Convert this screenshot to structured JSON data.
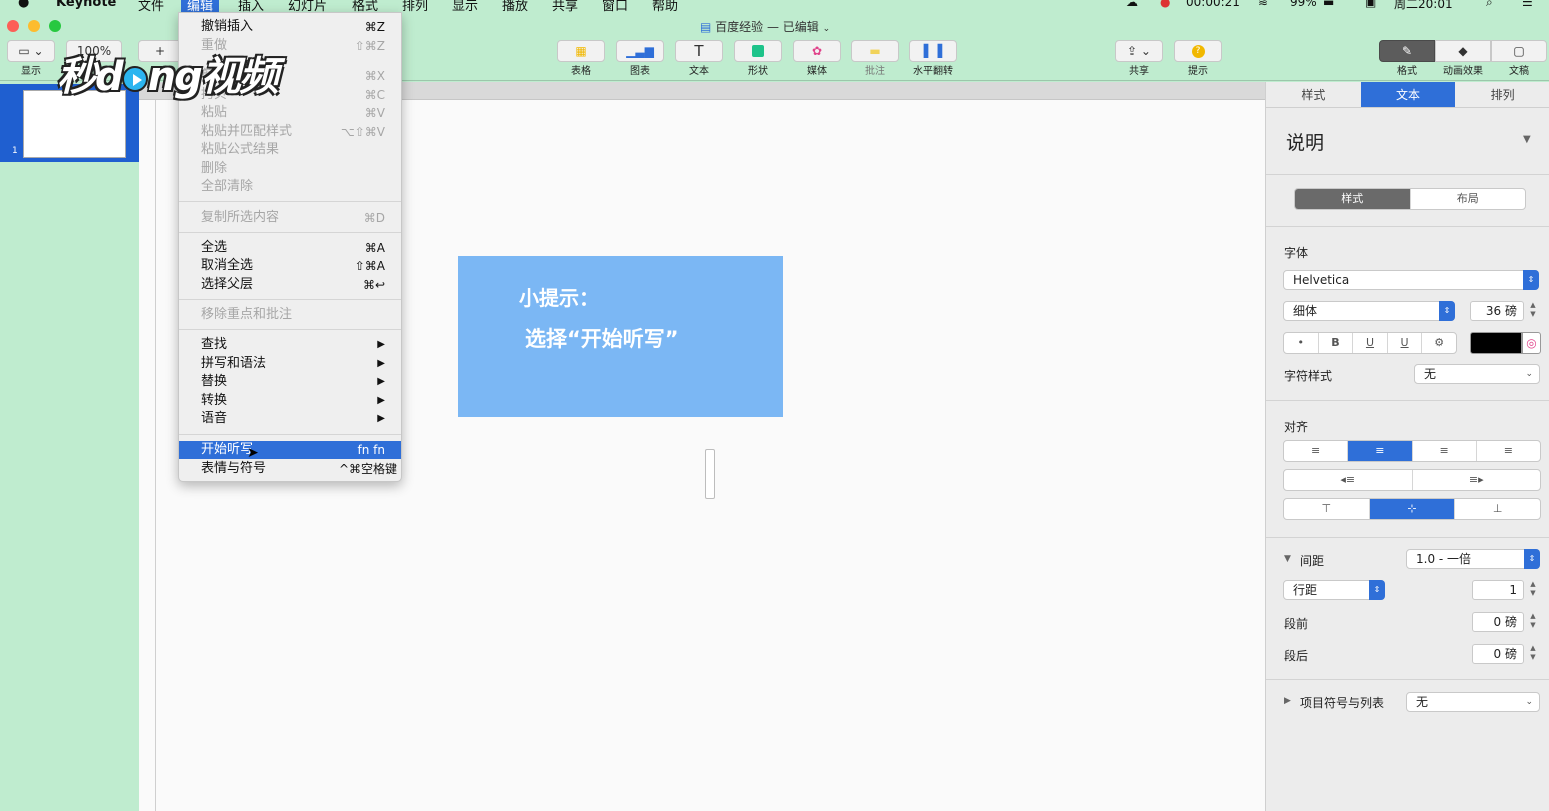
{
  "menubar": {
    "apple": "",
    "app": "Keynote",
    "items": [
      "文件",
      "编辑",
      "插入",
      "幻灯片",
      "格式",
      "排列",
      "显示",
      "播放",
      "共享",
      "窗口",
      "帮助"
    ],
    "active_index": 1,
    "recording_time": "00:00:21",
    "battery": "99%",
    "clock": "周二20:01"
  },
  "window": {
    "title": "百度经验 — 已编辑",
    "zoom": "100%"
  },
  "toolbar": {
    "left_labels": [
      "显示"
    ],
    "center": [
      {
        "label": "表格",
        "icon": "table-icon"
      },
      {
        "label": "图表",
        "icon": "chart-icon"
      },
      {
        "label": "文本",
        "icon": "text-icon"
      },
      {
        "label": "形状",
        "icon": "shape-icon"
      },
      {
        "label": "媒体",
        "icon": "media-icon"
      },
      {
        "label": "批注",
        "icon": "comment-icon"
      },
      {
        "label": "水平翻转",
        "icon": "flip-icon"
      }
    ],
    "share_label": "共享",
    "tips_label": "提示",
    "right": [
      {
        "label": "格式",
        "icon": "format-brush-icon"
      },
      {
        "label": "动画效果",
        "icon": "animate-icon"
      },
      {
        "label": "文稿",
        "icon": "document-icon"
      }
    ]
  },
  "navigator": {
    "slide_number": "1"
  },
  "slide": {
    "line1": "小提示：",
    "line2": "选择“开始听写”",
    "box_color": "#7bb7f4"
  },
  "edit_menu": {
    "items": [
      {
        "label": "撤销插入",
        "shortcut": "⌘Z",
        "disabled": false
      },
      {
        "label": "重做",
        "shortcut": "⇧⌘Z",
        "disabled": true
      },
      {
        "label": "剪切",
        "shortcut": "⌘X",
        "disabled": true
      },
      {
        "label": "拷贝",
        "shortcut": "⌘C",
        "disabled": true
      },
      {
        "label": "粘贴",
        "shortcut": "⌘V",
        "disabled": true
      },
      {
        "label": "粘贴并匹配样式",
        "shortcut": "⌥⇧⌘V",
        "disabled": true
      },
      {
        "label": "粘贴公式结果",
        "shortcut": "",
        "disabled": true
      },
      {
        "label": "删除",
        "shortcut": "",
        "disabled": true
      },
      {
        "label": "全部清除",
        "shortcut": "",
        "disabled": true
      },
      {
        "label": "复制所选内容",
        "shortcut": "⌘D",
        "disabled": true
      },
      {
        "label": "全选",
        "shortcut": "⌘A",
        "disabled": false
      },
      {
        "label": "取消全选",
        "shortcut": "⇧⌘A",
        "disabled": false
      },
      {
        "label": "选择父层",
        "shortcut": "⌘↩",
        "disabled": false
      },
      {
        "label": "移除重点和批注",
        "shortcut": "",
        "disabled": true
      },
      {
        "label": "查找",
        "shortcut": "▶",
        "disabled": false
      },
      {
        "label": "拼写和语法",
        "shortcut": "▶",
        "disabled": false
      },
      {
        "label": "替换",
        "shortcut": "▶",
        "disabled": false
      },
      {
        "label": "转换",
        "shortcut": "▶",
        "disabled": false
      },
      {
        "label": "语音",
        "shortcut": "▶",
        "disabled": false
      },
      {
        "label": "开始听写",
        "shortcut": "fn fn",
        "disabled": false,
        "highlighted": true
      },
      {
        "label": "表情与符号",
        "shortcut": "^⌘空格键",
        "disabled": false
      }
    ]
  },
  "watermark": {
    "text": "秒dong视频"
  },
  "inspector": {
    "tabs": [
      "样式",
      "文本",
      "排列"
    ],
    "active_tab": 1,
    "paragraph_style": "说明",
    "subtabs": [
      "样式",
      "布局"
    ],
    "font_label": "字体",
    "font_family": "Helvetica",
    "font_weight": "细体",
    "font_size": "36 磅",
    "style_buttons": [
      "•",
      "B",
      "U",
      "U",
      "⚙"
    ],
    "text_color": "#000000",
    "char_style_label": "字符样式",
    "char_style_value": "无",
    "align_label": "对齐",
    "spacing_label": "间距",
    "spacing_value": "1.0 - 一倍",
    "line_spacing_label": "行距",
    "line_spacing_value": "1",
    "before_label": "段前",
    "before_value": "0 磅",
    "after_label": "段后",
    "after_value": "0 磅",
    "bullets_label": "项目符号与列表",
    "bullets_value": "无"
  }
}
